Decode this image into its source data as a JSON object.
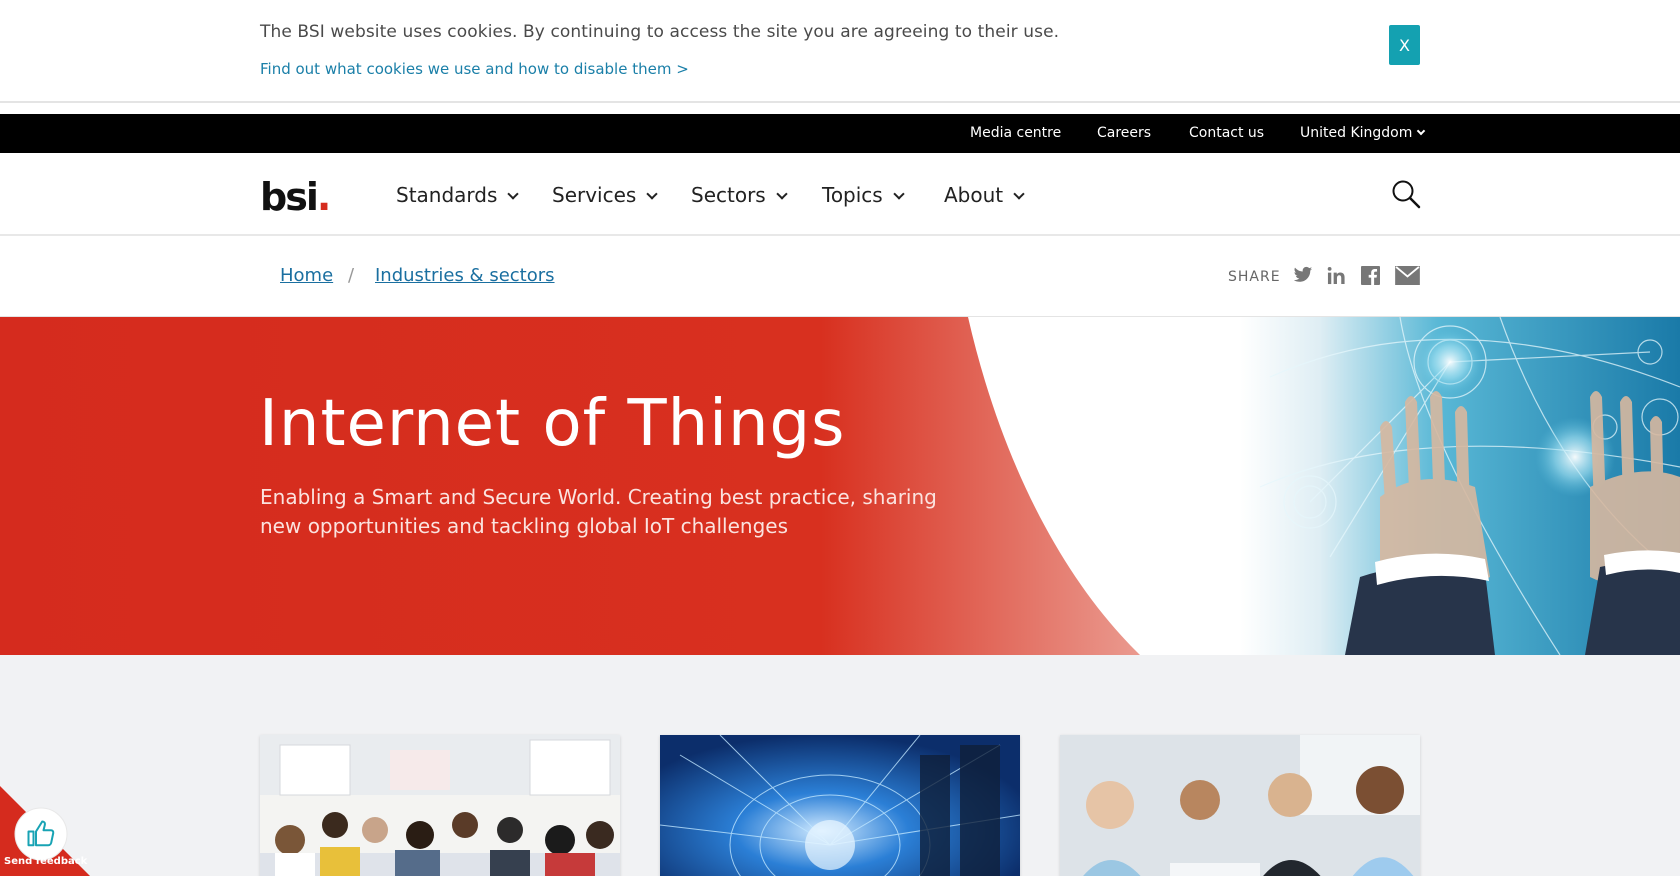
{
  "cookie_bar": {
    "message": "The BSI website uses cookies. By continuing to access the site you are agreeing to their use.",
    "link": "Find out what cookies we use and how to disable them >",
    "close_label": "X"
  },
  "top_bar": {
    "links": [
      "Media centre",
      "Careers",
      "Contact us"
    ],
    "region": "United Kingdom"
  },
  "main_nav": {
    "logo_text": "bsi",
    "logo_dot": ".",
    "items": [
      "Standards",
      "Services",
      "Sectors",
      "Topics",
      "About"
    ]
  },
  "breadcrumb": {
    "items": [
      "Home",
      "Industries & sectors"
    ],
    "separator": "/"
  },
  "share": {
    "label": "SHARE",
    "icons": [
      "twitter-icon",
      "linkedin-icon",
      "facebook-icon",
      "email-icon"
    ]
  },
  "hero": {
    "title": "Internet of Things",
    "subtitle": "Enabling a Smart and Secure World. Creating best practice, sharing new opportunities and tackling global IoT challenges"
  },
  "feedback": {
    "label": "Send feedback"
  },
  "colors": {
    "brand_red": "#d52b1e",
    "accent_teal": "#14a1b1",
    "link_blue": "#1a6fa0"
  }
}
